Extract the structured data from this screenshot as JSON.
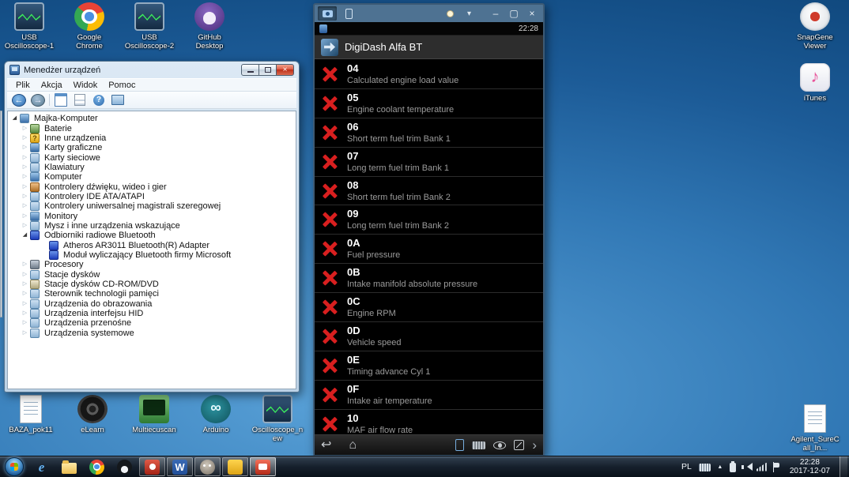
{
  "desktop": {
    "top_icons": [
      {
        "label": "USB Oscilloscope-1",
        "icon": "oscilloscope-icon"
      },
      {
        "label": "Google Chrome",
        "icon": "chrome-icon"
      },
      {
        "label": "USB Oscilloscope-2",
        "icon": "oscilloscope-icon"
      },
      {
        "label": "GitHub Desktop",
        "icon": "github-icon"
      }
    ],
    "right_icons": [
      {
        "label": "SnapGene Viewer",
        "icon": "snapgene-icon"
      },
      {
        "label": "iTunes",
        "icon": "itunes-icon"
      }
    ],
    "right_bottom_icons": [
      {
        "label": "Agilent_SureCall_In...",
        "icon": "document-icon"
      }
    ],
    "bottom_icons": [
      {
        "label": "BAZA_pok11",
        "icon": "document-icon"
      },
      {
        "label": "eLearn",
        "icon": "disc-icon"
      },
      {
        "label": "Multiecuscan",
        "icon": "multiecuscan-icon"
      },
      {
        "label": "Arduino",
        "icon": "arduino-icon"
      },
      {
        "label": "Oscilloscope_new",
        "icon": "oscilloscope-icon"
      }
    ]
  },
  "device_manager": {
    "title": "Menedżer urządzeń",
    "menu_items": [
      {
        "label": "Plik"
      },
      {
        "label": "Akcja"
      },
      {
        "label": "Widok"
      },
      {
        "label": "Pomoc"
      }
    ],
    "toolbar_icons": [
      {
        "icon": "back-icon"
      },
      {
        "icon": "forward-icon"
      },
      {
        "icon": "separator"
      },
      {
        "icon": "console-window-icon"
      },
      {
        "icon": "export-list-icon"
      },
      {
        "icon": "help-icon"
      },
      {
        "icon": "scan-hardware-icon"
      }
    ],
    "tree": [
      {
        "label": "Majka-Komputer",
        "level": 0,
        "state": "expanded",
        "icon": "computer-icon"
      },
      {
        "label": "Baterie",
        "level": 1,
        "state": "collapsed",
        "icon": "battery-icon"
      },
      {
        "label": "Inne urządzenia",
        "level": 1,
        "state": "collapsed",
        "icon": "unknown-device-icon"
      },
      {
        "label": "Karty graficzne",
        "level": 1,
        "state": "collapsed",
        "icon": "display-adapter-icon"
      },
      {
        "label": "Karty sieciowe",
        "level": 1,
        "state": "collapsed",
        "icon": "network-adapter-icon"
      },
      {
        "label": "Klawiatury",
        "level": 1,
        "state": "collapsed",
        "icon": "keyboard-device-icon"
      },
      {
        "label": "Komputer",
        "level": 1,
        "state": "collapsed",
        "icon": "computer-icon"
      },
      {
        "label": "Kontrolery dźwięku, wideo i gier",
        "level": 1,
        "state": "collapsed",
        "icon": "audio-icon"
      },
      {
        "label": "Kontrolery IDE ATA/ATAPI",
        "level": 1,
        "state": "collapsed",
        "icon": "ide-icon"
      },
      {
        "label": "Kontrolery uniwersalnej magistrali szeregowej",
        "level": 1,
        "state": "collapsed",
        "icon": "usb-icon"
      },
      {
        "label": "Monitory",
        "level": 1,
        "state": "collapsed",
        "icon": "monitor-icon"
      },
      {
        "label": "Mysz i inne urządzenia wskazujące",
        "level": 1,
        "state": "collapsed",
        "icon": "mouse-icon"
      },
      {
        "label": "Odbiorniki radiowe Bluetooth",
        "level": 1,
        "state": "expanded",
        "icon": "bluetooth-icon"
      },
      {
        "label": "Atheros AR3011 Bluetooth(R) Adapter",
        "level": 2,
        "state": "leaf",
        "icon": "bluetooth-icon"
      },
      {
        "label": "Moduł wyliczający Bluetooth firmy Microsoft",
        "level": 2,
        "state": "leaf",
        "icon": "bluetooth-icon"
      },
      {
        "label": "Procesory",
        "level": 1,
        "state": "collapsed",
        "icon": "cpu-icon"
      },
      {
        "label": "Stacje dysków",
        "level": 1,
        "state": "collapsed",
        "icon": "disk-icon"
      },
      {
        "label": "Stacje dysków CD-ROM/DVD",
        "level": 1,
        "state": "collapsed",
        "icon": "cdrom-icon"
      },
      {
        "label": "Sterownik technologii pamięci",
        "level": 1,
        "state": "collapsed",
        "icon": "storage-icon"
      },
      {
        "label": "Urządzenia do obrazowania",
        "level": 1,
        "state": "collapsed",
        "icon": "imaging-icon"
      },
      {
        "label": "Urządzenia interfejsu HID",
        "level": 1,
        "state": "collapsed",
        "icon": "hid-icon"
      },
      {
        "label": "Urządzenia przenośne",
        "level": 1,
        "state": "collapsed",
        "icon": "portable-icon"
      },
      {
        "label": "Urządzenia systemowe",
        "level": 1,
        "state": "collapsed",
        "icon": "system-icon"
      }
    ]
  },
  "android": {
    "status_time": "22:28",
    "app_title": "DigiDash Alfa BT",
    "titlebar_tabs": [
      {
        "icon": "screenshot-tab-icon",
        "active": "true"
      },
      {
        "icon": "device-tab-icon",
        "active": "false"
      }
    ],
    "pids": [
      {
        "code": "04",
        "desc": "Calculated engine load value"
      },
      {
        "code": "05",
        "desc": "Engine coolant temperature"
      },
      {
        "code": "06",
        "desc": "Short term fuel trim Bank 1"
      },
      {
        "code": "07",
        "desc": "Long term fuel trim Bank 1"
      },
      {
        "code": "08",
        "desc": "Short term fuel trim Bank 2"
      },
      {
        "code": "09",
        "desc": "Long term fuel trim Bank 2"
      },
      {
        "code": "0A",
        "desc": "Fuel pressure"
      },
      {
        "code": "0B",
        "desc": "Intake manifold absolute pressure"
      },
      {
        "code": "0C",
        "desc": "Engine RPM"
      },
      {
        "code": "0D",
        "desc": "Vehicle speed"
      },
      {
        "code": "0E",
        "desc": "Timing advance Cyl 1"
      },
      {
        "code": "0F",
        "desc": "Intake air temperature"
      },
      {
        "code": "10",
        "desc": "MAF air flow rate"
      }
    ],
    "nav_icons_left": [
      {
        "icon": "back-icon"
      },
      {
        "icon": "home-icon"
      }
    ],
    "nav_icons_right": [
      {
        "icon": "device-blue-icon"
      },
      {
        "icon": "keyboard-icon"
      },
      {
        "icon": "eye-icon"
      },
      {
        "icon": "fullscreen-icon"
      },
      {
        "icon": "chevron-right-icon"
      }
    ]
  },
  "taskbar": {
    "apps": [
      {
        "name": "internet-explorer",
        "icon": "ie-icon",
        "state": "pinned"
      },
      {
        "name": "windows-explorer",
        "icon": "folder-icon",
        "state": "pinned"
      },
      {
        "name": "google-chrome",
        "icon": "chrome-icon",
        "state": "pinned"
      },
      {
        "name": "qq",
        "icon": "qq-icon",
        "state": "pinned"
      },
      {
        "name": "red-app",
        "icon": "red-app-icon",
        "state": "running"
      },
      {
        "name": "word",
        "icon": "word-icon",
        "state": "running"
      },
      {
        "name": "gimp",
        "icon": "gimp-icon",
        "state": "running"
      },
      {
        "name": "yellow-app",
        "icon": "yellow-app-icon",
        "state": "running"
      },
      {
        "name": "red-app-2",
        "icon": "red-app2-icon",
        "state": "active"
      }
    ],
    "tray_icons": [
      {
        "icon": "keyboard-icon"
      },
      {
        "icon": "hidden-icons-icon"
      },
      {
        "icon": "power-icon"
      },
      {
        "icon": "volume-icon"
      },
      {
        "icon": "network-icon"
      },
      {
        "icon": "flag-icon"
      }
    ],
    "tray": {
      "language": "PL",
      "time": "22:28",
      "date": "2017-12-07"
    }
  }
}
